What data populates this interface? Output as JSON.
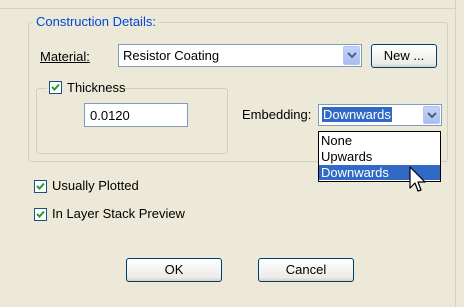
{
  "construction": {
    "group_title": "Construction Details:",
    "material": {
      "label": "Material:",
      "value": "Resistor Coating",
      "new_button": "New ..."
    },
    "thickness": {
      "label": "Thickness",
      "checked": true,
      "value": "0.0120"
    },
    "embedding": {
      "label": "Embedding:",
      "selected": "Downwards",
      "options": [
        "None",
        "Upwards",
        "Downwards"
      ],
      "highlighted": "Downwards"
    }
  },
  "options": {
    "usually_plotted": {
      "label": "Usually Plotted",
      "checked": true
    },
    "layer_stack_preview": {
      "label": "In Layer Stack Preview",
      "checked": true
    }
  },
  "buttons": {
    "ok": "OK",
    "cancel": "Cancel"
  },
  "colors": {
    "dialog_bg": "#ece9d8",
    "group_title": "#0046d5",
    "selection": "#316ac5"
  }
}
